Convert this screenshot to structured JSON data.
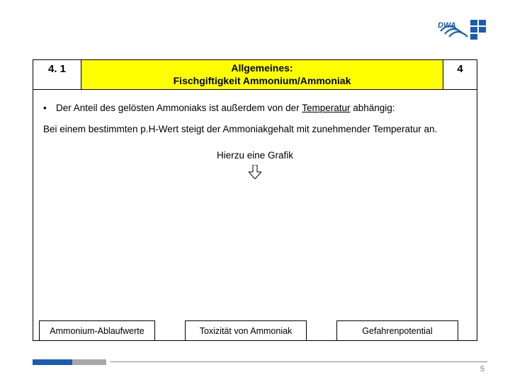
{
  "header": {
    "section_number": "4. 1",
    "title_line1": "Allgemeines:",
    "title_line2": "Fischgiftigkeit Ammonium/Ammoniak",
    "right_number": "4"
  },
  "body": {
    "bullet_text_before": "Der Anteil des gelösten Ammoniaks ist außerdem von der ",
    "bullet_text_underlined": "Temperatur",
    "bullet_text_after": "  abhängig:",
    "paragraph": "Bei einem bestimmten p.H-Wert steigt der Ammoniakgehalt mit zunehmender Temperatur an.",
    "grafik_label": "Hierzu eine Grafik"
  },
  "bottom_boxes": {
    "box1": "Ammonium-Ablaufwerte",
    "box2": "Toxizität von Ammoniak",
    "box3": "Gefahrenpotential"
  },
  "footer": {
    "page_number": "5"
  }
}
